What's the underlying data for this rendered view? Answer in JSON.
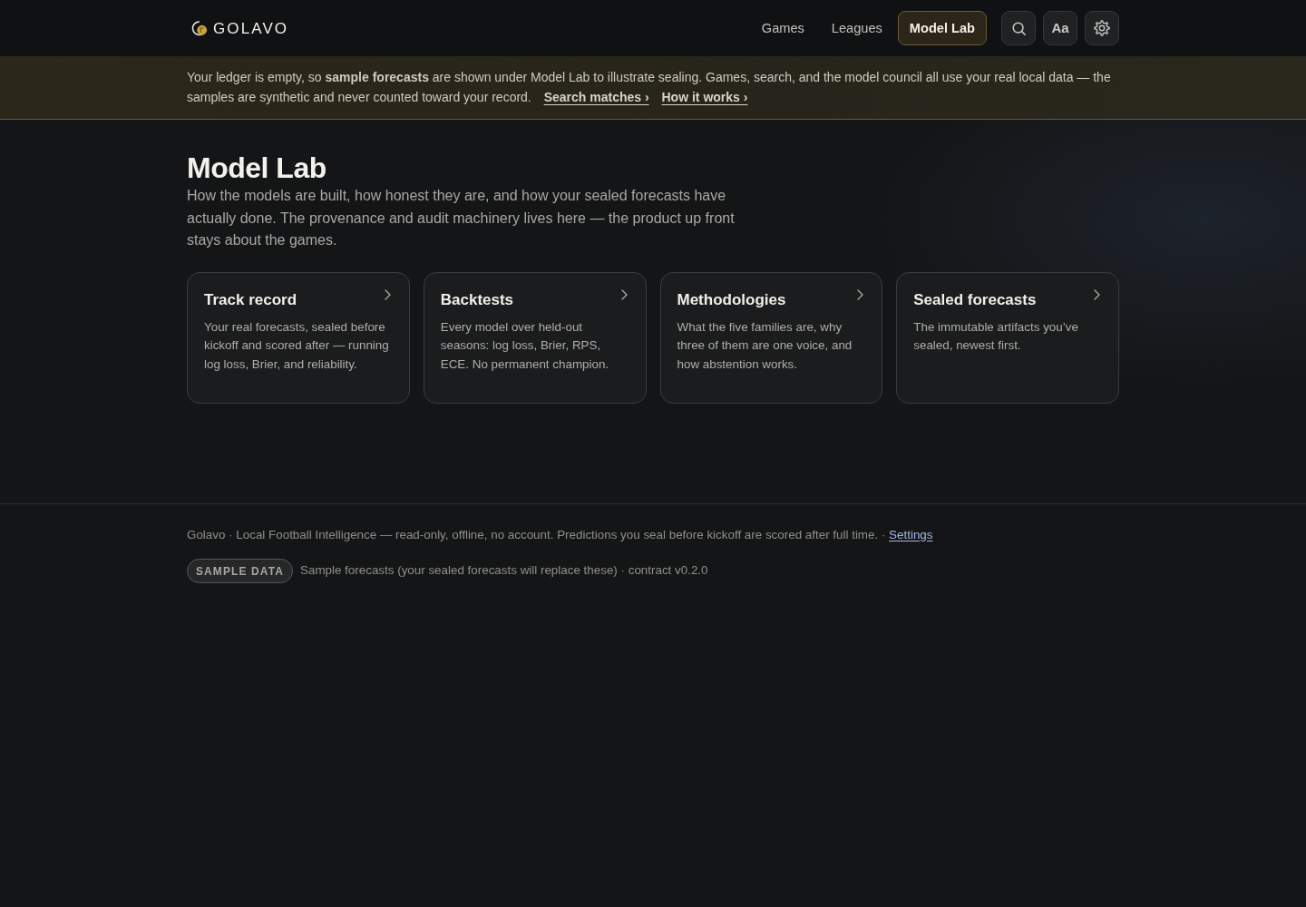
{
  "brand": {
    "name": "GOLAVO"
  },
  "nav": {
    "links": [
      {
        "label": "Games",
        "selected": false
      },
      {
        "label": "Leagues",
        "selected": false
      },
      {
        "label": "Model Lab",
        "selected": true
      }
    ],
    "tools": [
      {
        "kind": "search"
      },
      {
        "kind": "text_size",
        "label": "Aa"
      },
      {
        "kind": "settings"
      }
    ]
  },
  "notice": {
    "text": "Your ledger is empty, so **sample forecasts** are shown under Model Lab to illustrate sealing. Games, search, and the model council all use your real local data — the samples are synthetic and never counted toward your record.",
    "links": [
      "Search matches ›",
      "How it works ›"
    ]
  },
  "page": {
    "title": "Model Lab",
    "intro": "How the models are built, how honest they are, and how your sealed forecasts have actually done. The provenance and audit machinery lives here — the product up front stays about the games."
  },
  "cards": [
    {
      "title": "Track record",
      "description": "Your real forecasts, sealed before kickoff and scored after — running log loss, Brier, and reliability."
    },
    {
      "title": "Backtests",
      "description": "Every model over held-out seasons: log loss, Brier, RPS, ECE. No permanent champion."
    },
    {
      "title": "Methodologies",
      "description": "What the five families are, why three of them are one voice, and how abstention works."
    },
    {
      "title": "Sealed forecasts",
      "description": "The immutable artifacts you’ve sealed, newest first."
    }
  ],
  "footer": {
    "text": "Golavo · Local Football Intelligence — read-only, offline, no account. Predictions you seal before kickoff are scored after full time. ·",
    "link": "Settings",
    "badge": "SAMPLE DATA",
    "note": "Sample forecasts (your sealed forecasts will replace these) · contract v0.2.0"
  }
}
